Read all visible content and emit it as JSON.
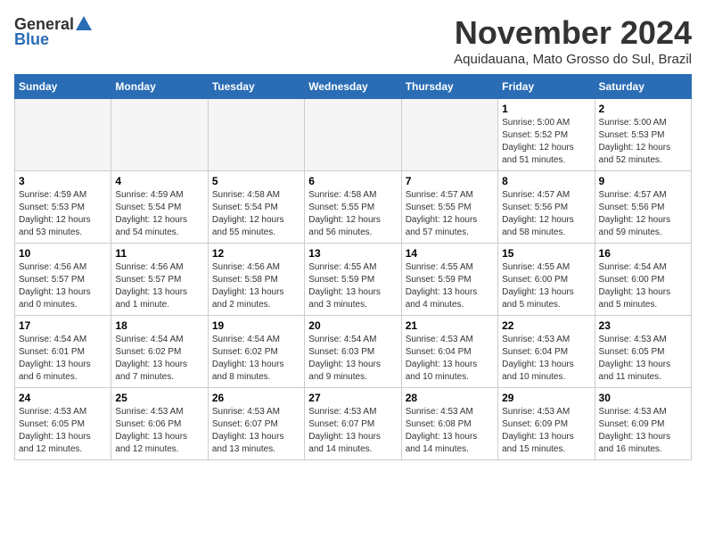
{
  "logo": {
    "general": "General",
    "blue": "Blue"
  },
  "title": "November 2024",
  "subtitle": "Aquidauana, Mato Grosso do Sul, Brazil",
  "weekdays": [
    "Sunday",
    "Monday",
    "Tuesday",
    "Wednesday",
    "Thursday",
    "Friday",
    "Saturday"
  ],
  "weeks": [
    [
      {
        "day": "",
        "empty": true
      },
      {
        "day": "",
        "empty": true
      },
      {
        "day": "",
        "empty": true
      },
      {
        "day": "",
        "empty": true
      },
      {
        "day": "",
        "empty": true
      },
      {
        "day": "1",
        "sunrise": "5:00 AM",
        "sunset": "5:52 PM",
        "daylight": "12 hours and 51 minutes."
      },
      {
        "day": "2",
        "sunrise": "5:00 AM",
        "sunset": "5:53 PM",
        "daylight": "12 hours and 52 minutes."
      }
    ],
    [
      {
        "day": "3",
        "sunrise": "4:59 AM",
        "sunset": "5:53 PM",
        "daylight": "12 hours and 53 minutes."
      },
      {
        "day": "4",
        "sunrise": "4:59 AM",
        "sunset": "5:54 PM",
        "daylight": "12 hours and 54 minutes."
      },
      {
        "day": "5",
        "sunrise": "4:58 AM",
        "sunset": "5:54 PM",
        "daylight": "12 hours and 55 minutes."
      },
      {
        "day": "6",
        "sunrise": "4:58 AM",
        "sunset": "5:55 PM",
        "daylight": "12 hours and 56 minutes."
      },
      {
        "day": "7",
        "sunrise": "4:57 AM",
        "sunset": "5:55 PM",
        "daylight": "12 hours and 57 minutes."
      },
      {
        "day": "8",
        "sunrise": "4:57 AM",
        "sunset": "5:56 PM",
        "daylight": "12 hours and 58 minutes."
      },
      {
        "day": "9",
        "sunrise": "4:57 AM",
        "sunset": "5:56 PM",
        "daylight": "12 hours and 59 minutes."
      }
    ],
    [
      {
        "day": "10",
        "sunrise": "4:56 AM",
        "sunset": "5:57 PM",
        "daylight": "13 hours and 0 minutes."
      },
      {
        "day": "11",
        "sunrise": "4:56 AM",
        "sunset": "5:57 PM",
        "daylight": "13 hours and 1 minute."
      },
      {
        "day": "12",
        "sunrise": "4:56 AM",
        "sunset": "5:58 PM",
        "daylight": "13 hours and 2 minutes."
      },
      {
        "day": "13",
        "sunrise": "4:55 AM",
        "sunset": "5:59 PM",
        "daylight": "13 hours and 3 minutes."
      },
      {
        "day": "14",
        "sunrise": "4:55 AM",
        "sunset": "5:59 PM",
        "daylight": "13 hours and 4 minutes."
      },
      {
        "day": "15",
        "sunrise": "4:55 AM",
        "sunset": "6:00 PM",
        "daylight": "13 hours and 5 minutes."
      },
      {
        "day": "16",
        "sunrise": "4:54 AM",
        "sunset": "6:00 PM",
        "daylight": "13 hours and 5 minutes."
      }
    ],
    [
      {
        "day": "17",
        "sunrise": "4:54 AM",
        "sunset": "6:01 PM",
        "daylight": "13 hours and 6 minutes."
      },
      {
        "day": "18",
        "sunrise": "4:54 AM",
        "sunset": "6:02 PM",
        "daylight": "13 hours and 7 minutes."
      },
      {
        "day": "19",
        "sunrise": "4:54 AM",
        "sunset": "6:02 PM",
        "daylight": "13 hours and 8 minutes."
      },
      {
        "day": "20",
        "sunrise": "4:54 AM",
        "sunset": "6:03 PM",
        "daylight": "13 hours and 9 minutes."
      },
      {
        "day": "21",
        "sunrise": "4:53 AM",
        "sunset": "6:04 PM",
        "daylight": "13 hours and 10 minutes."
      },
      {
        "day": "22",
        "sunrise": "4:53 AM",
        "sunset": "6:04 PM",
        "daylight": "13 hours and 10 minutes."
      },
      {
        "day": "23",
        "sunrise": "4:53 AM",
        "sunset": "6:05 PM",
        "daylight": "13 hours and 11 minutes."
      }
    ],
    [
      {
        "day": "24",
        "sunrise": "4:53 AM",
        "sunset": "6:05 PM",
        "daylight": "13 hours and 12 minutes."
      },
      {
        "day": "25",
        "sunrise": "4:53 AM",
        "sunset": "6:06 PM",
        "daylight": "13 hours and 12 minutes."
      },
      {
        "day": "26",
        "sunrise": "4:53 AM",
        "sunset": "6:07 PM",
        "daylight": "13 hours and 13 minutes."
      },
      {
        "day": "27",
        "sunrise": "4:53 AM",
        "sunset": "6:07 PM",
        "daylight": "13 hours and 14 minutes."
      },
      {
        "day": "28",
        "sunrise": "4:53 AM",
        "sunset": "6:08 PM",
        "daylight": "13 hours and 14 minutes."
      },
      {
        "day": "29",
        "sunrise": "4:53 AM",
        "sunset": "6:09 PM",
        "daylight": "13 hours and 15 minutes."
      },
      {
        "day": "30",
        "sunrise": "4:53 AM",
        "sunset": "6:09 PM",
        "daylight": "13 hours and 16 minutes."
      }
    ]
  ],
  "labels": {
    "sunrise": "Sunrise:",
    "sunset": "Sunset:",
    "daylight": "Daylight:"
  }
}
